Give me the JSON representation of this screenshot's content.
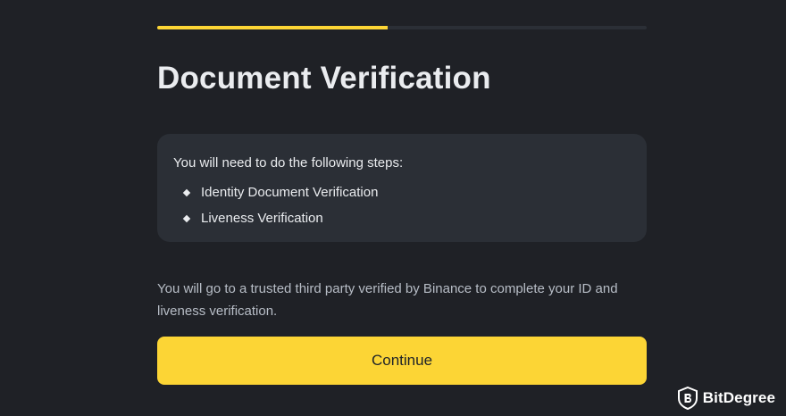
{
  "progress": {
    "fraction": 0.47,
    "fill_color": "#fcd535",
    "track_color": "#2b2f36"
  },
  "page": {
    "title": "Document Verification"
  },
  "steps_card": {
    "intro": "You will need to do the following steps:",
    "items": [
      "Identity Document Verification",
      "Liveness Verification"
    ]
  },
  "note": {
    "text": "You will go to a trusted third party verified by Binance to complete your ID and liveness verification."
  },
  "actions": {
    "continue_label": "Continue"
  },
  "watermark": {
    "brand": "BitDegree",
    "icon": "bitdegree-shield-icon"
  },
  "colors": {
    "background": "#1f2126",
    "accent": "#fcd535",
    "card": "#2b2f36",
    "text_primary": "#eaecef",
    "text_secondary": "#b7bdc6"
  }
}
